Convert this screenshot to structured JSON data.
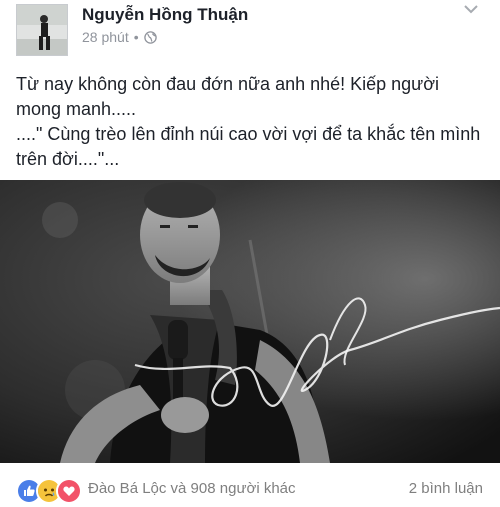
{
  "post": {
    "author": "Nguyễn Hồng Thuận",
    "time": "28 phút",
    "separator": "•",
    "privacy_icon": "globe-icon",
    "menu_icon": "chevron-down-icon",
    "text_lines": [
      "Từ nay không còn đau đớn nữa anh nhé! Kiếp người mong manh.....",
      "....\" Cùng trèo lên đỉnh núi cao vời vợi để ta khắc tên mình trên đời....\"..."
    ],
    "photo_signature_icon": "signature-watermark"
  },
  "reactions": {
    "icons": [
      "like-icon",
      "sad-icon",
      "love-icon"
    ],
    "names": "Đào Bá Lộc và 908 người khác",
    "comments": "2 bình luận"
  },
  "colors": {
    "like": "#4a7ee8",
    "sad": "#f5c33b",
    "love": "#f25268",
    "meta": "#90949c",
    "text": "#1d2129"
  }
}
